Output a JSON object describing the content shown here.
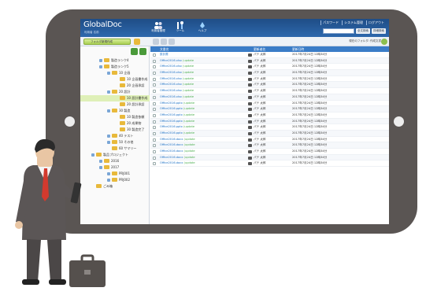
{
  "app": {
    "logo": "GlobalDoc",
    "logo_sub": "利用者 名前",
    "nav": [
      {
        "icon": "people-icon",
        "label": "利用者管理"
      },
      {
        "icon": "tools-icon",
        "label": "ツール"
      },
      {
        "icon": "help-icon",
        "label": "ヘルプ"
      }
    ],
    "top_links": [
      "パスワード",
      "システム管理",
      "ログアウト"
    ],
    "top_buttons": [
      "全文検索",
      "詳細検索"
    ]
  },
  "toolbar": {
    "new_label": "フォルダ新規作成",
    "path_info": "現在のフォルダ: 作成文書"
  },
  "tree": [
    {
      "indent": 1,
      "label": "製造ランク4",
      "toggle": true
    },
    {
      "indent": 1,
      "label": "製造ランク5",
      "toggle": true
    },
    {
      "indent": 2,
      "label": "10 企画",
      "toggle": true
    },
    {
      "indent": 3,
      "label": "10 企画書作成",
      "toggle": false
    },
    {
      "indent": 3,
      "label": "20 企画承認",
      "toggle": false
    },
    {
      "indent": 2,
      "label": "20 設計",
      "toggle": true
    },
    {
      "indent": 3,
      "label": "10 設計書作成",
      "toggle": false,
      "selected": true
    },
    {
      "indent": 3,
      "label": "20 設計承認",
      "toggle": false
    },
    {
      "indent": 2,
      "label": "30 製造",
      "toggle": true
    },
    {
      "indent": 3,
      "label": "10 製造依頼",
      "toggle": false
    },
    {
      "indent": 3,
      "label": "20 成果物",
      "toggle": false
    },
    {
      "indent": 3,
      "label": "30 製造完了",
      "toggle": false
    },
    {
      "indent": 2,
      "label": "40 テスト",
      "toggle": true
    },
    {
      "indent": 2,
      "label": "50 その他",
      "toggle": true
    },
    {
      "indent": 2,
      "label": "60 サマリー",
      "toggle": false
    },
    {
      "indent": 0,
      "label": "製品プロジェクト",
      "toggle": true
    },
    {
      "indent": 1,
      "label": "2016",
      "toggle": true
    },
    {
      "indent": 1,
      "label": "2017",
      "toggle": true
    },
    {
      "indent": 2,
      "label": "PRJ001",
      "toggle": true
    },
    {
      "indent": 2,
      "label": "PRJ002",
      "toggle": true
    },
    {
      "indent": 0,
      "label": "ごみ箱",
      "toggle": false
    }
  ],
  "table": {
    "columns": [
      "文書名",
      "更新者名",
      "更新日時"
    ],
    "rows": [
      {
        "name": "設計書",
        "ext": "",
        "user": "パテ 太郎",
        "date": "2017年7月24日 12時34分"
      },
      {
        "name": "Office2016.xlsx",
        "ext": " (update",
        "user": "パテ 太郎",
        "date": "2017年7月24日 12時34分"
      },
      {
        "name": "Office2016.xlsx",
        "ext": " (update",
        "user": "パテ 太郎",
        "date": "2017年7月24日 12時34分"
      },
      {
        "name": "Office2016.xlsx",
        "ext": " (update",
        "user": "パテ 太郎",
        "date": "2017年7月24日 12時34分"
      },
      {
        "name": "Office2016.xlsx",
        "ext": " (update",
        "user": "パテ 太郎",
        "date": "2017年7月24日 12時34分"
      },
      {
        "name": "Office2016.xlsx",
        "ext": " (update",
        "user": "パテ 太郎",
        "date": "2017年7月24日 12時34分"
      },
      {
        "name": "Office2016.xlsx",
        "ext": " (update",
        "user": "パテ 太郎",
        "date": "2017年7月24日 12時34分"
      },
      {
        "name": "Office2016.xlsx",
        "ext": " (update",
        "user": "パテ 太郎",
        "date": "2017年7月24日 12時34分"
      },
      {
        "name": "Office2016.pptx",
        "ext": " (update",
        "user": "パテ 太郎",
        "date": "2017年7月24日 12時34分"
      },
      {
        "name": "Office2016.pptx",
        "ext": " (update",
        "user": "パテ 太郎",
        "date": "2017年7月24日 12時34分"
      },
      {
        "name": "Office2016.pptx",
        "ext": " (update",
        "user": "パテ 太郎",
        "date": "2017年7月24日 12時34分"
      },
      {
        "name": "Office2016.pptx",
        "ext": " (update",
        "user": "パテ 太郎",
        "date": "2017年7月24日 12時34分"
      },
      {
        "name": "Office2016.pptx",
        "ext": " (update",
        "user": "パテ 太郎",
        "date": "2017年7月24日 12時34分"
      },
      {
        "name": "Office2016.pptx",
        "ext": " (update",
        "user": "パテ 太郎",
        "date": "2017年7月24日 12時34分"
      },
      {
        "name": "Office2016.docx",
        "ext": " (update",
        "user": "パテ 太郎",
        "date": "2017年7月24日 12時34分"
      },
      {
        "name": "Office2016.docx",
        "ext": " (update",
        "user": "パテ 太郎",
        "date": "2017年7月24日 12時34分"
      },
      {
        "name": "Office2016.docx",
        "ext": " (update",
        "user": "パテ 太郎",
        "date": "2017年7月24日 12時34分"
      },
      {
        "name": "Office2016.docx",
        "ext": " (update",
        "user": "パテ 太郎",
        "date": "2017年7月24日 12時34分"
      },
      {
        "name": "Office2016.docx",
        "ext": " (update",
        "user": "パテ 太郎",
        "date": "2017年7月24日 12時34分"
      }
    ]
  },
  "colors": {
    "header_blue": "#2d68ad",
    "tablet_frame": "#5a5553",
    "new_button_green": "#a9cf52",
    "folder_yellow": "#e8b93b",
    "selected_row": "#dff0b8"
  }
}
